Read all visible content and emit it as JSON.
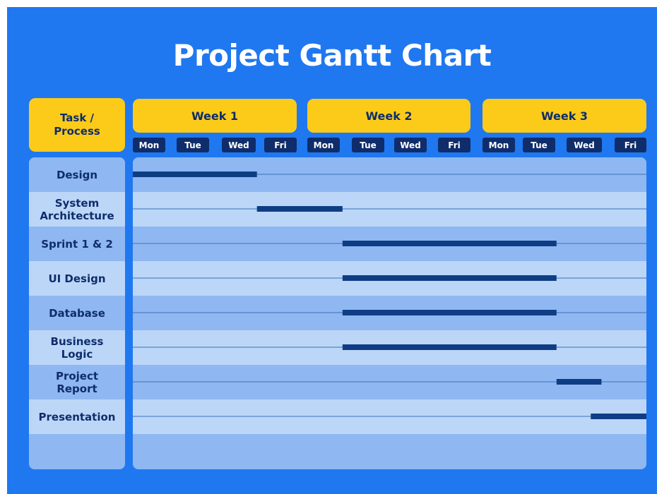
{
  "title": "Project Gantt Chart",
  "colors": {
    "background": "#1f78ef",
    "header_fill": "#fccb1a",
    "header_text": "#0f2d6b",
    "row_dark": "#8fb7f2",
    "row_light": "#bcd6f8",
    "bar": "#0f3d84",
    "gridline": "#3d73b8"
  },
  "chart_data": {
    "type": "gantt",
    "title": "Project Gantt Chart",
    "task_header": "Task /\nProcess",
    "weeks": [
      "Week 1",
      "Week 2",
      "Week 3"
    ],
    "days": [
      "Mon",
      "Tue",
      "Wed",
      "Fri",
      "Mon",
      "Tue",
      "Wed",
      "Fri",
      "Mon",
      "Tue",
      "Wed",
      "Fri"
    ],
    "tasks": [
      {
        "name": "Design",
        "start": 0.0,
        "end": 2.9
      },
      {
        "name": "System Architecture",
        "start": 2.9,
        "end": 4.9
      },
      {
        "name": "Sprint 1 & 2",
        "start": 4.9,
        "end": 9.9
      },
      {
        "name": "UI Design",
        "start": 4.9,
        "end": 9.9
      },
      {
        "name": "Database",
        "start": 4.9,
        "end": 9.9
      },
      {
        "name": "Business Logic",
        "start": 4.9,
        "end": 9.9
      },
      {
        "name": "Project Report",
        "start": 9.9,
        "end": 10.95
      },
      {
        "name": "Presentation",
        "start": 10.7,
        "end": 12.0
      }
    ]
  }
}
